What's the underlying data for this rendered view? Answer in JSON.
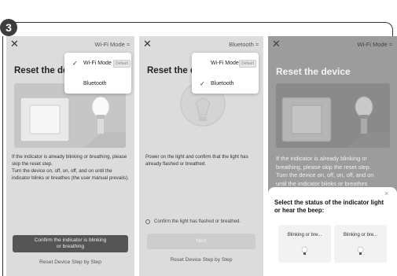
{
  "step": {
    "number": "3"
  },
  "panel1": {
    "close_icon": "close-icon",
    "mode_label": "Wi-Fi Mode ≈",
    "title": "Reset the device",
    "dropdown": [
      {
        "label": "Wi-Fi Mode",
        "badge": "Default",
        "checked": true
      },
      {
        "label": "Bluetooth",
        "badge": "",
        "checked": false
      }
    ],
    "desc_lines": [
      "If the indicator is already blinking or breathing, please",
      "skip the reset step.",
      "Turn the device on, off, on, off, and on until the",
      "indicator blinks or breathes (the user manual prevails)."
    ],
    "primary_button_lines": [
      "Confirm the indicator is blinking",
      "or breathing"
    ],
    "link": "Reset Device Step by Step"
  },
  "panel2": {
    "close_icon": "close-icon",
    "mode_label": "Bluetooth ≈",
    "title": "Reset the dev",
    "dropdown": [
      {
        "label": "Wi-Fi Mode",
        "badge": "Default",
        "checked": false
      },
      {
        "label": "Bluetooth",
        "badge": "",
        "checked": true
      }
    ],
    "desc_lines": [
      "Power on the light and confirm that the light has",
      "already flashed or breathed."
    ],
    "radio_label": "Confirm the light has flashed or breathed.",
    "next_button": "Next",
    "link": "Reset Device Step by Step"
  },
  "panel3": {
    "close_icon": "close-icon",
    "mode_label": "Wi-Fi Mode ≈",
    "title": "Reset the device",
    "desc_lines": [
      "If the indicator is already blinking or",
      "breathing, please skip the reset step.",
      "Turn the device on, off, on, off, and on",
      "until the indicator blinks or breathes"
    ],
    "sheet": {
      "close_icon": "close-icon",
      "title_lines": [
        "Select the status of the indicator light",
        "or hear the beep:"
      ],
      "options": [
        "Blinking or bre...",
        "Blinking or bre..."
      ]
    }
  },
  "colors": {
    "panel_bg": "#dcdcdc",
    "dim_bg": "#9c9c9c",
    "primary_button": "#555555",
    "disabled_button": "#cdcdcd"
  }
}
